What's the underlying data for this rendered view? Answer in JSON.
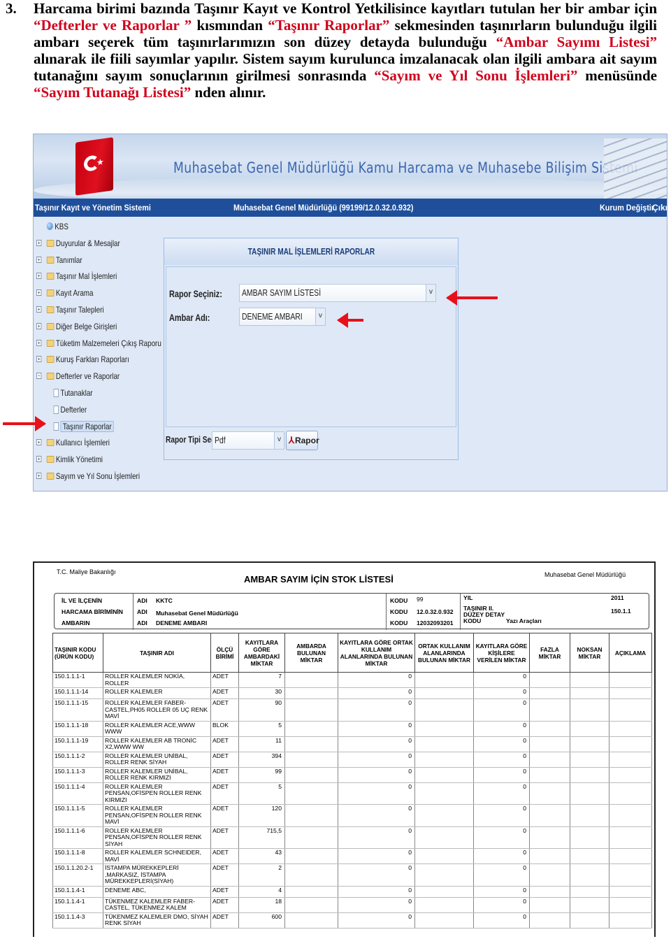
{
  "intro": {
    "number": "3.",
    "p1": "Harcama birimi bazında Taşınır Kayıt ve Kontrol Yetkilisince kayıtları tutulan her bir ambar için ",
    "p2": "“Defterler ve Raporlar ”",
    "p3": " kısmından ",
    "p4": "“Taşınır Raporlar”",
    "p5": " sekmesinden taşınırların bulunduğu ilgili ambarı seçerek tüm taşınırlarımızın son düzey detayda bulunduğu ",
    "p6": "“Ambar Sayımı Listesi”",
    "p7": " alınarak ile fiili sayımlar yapılır. Sistem sayım kurulunca imzalanacak olan ilgili ambara ait sayım tutanağını sayım sonuçlarının girilmesi sonrasında ",
    "p8": "“Sayım ve Yıl Sonu İşlemleri”",
    "p9": " menüsünde ",
    "p10": "“Sayım Tutanağı Listesi”",
    "p11": " nden alınır."
  },
  "app": {
    "banner_title": "Muhasebat Genel Müdürlüğü Kamu Harcama ve Muhasebe Bilişim Sistemi",
    "nav_left": "Taşınır Kayıt ve Yönetim Sistemi",
    "nav_center": "Muhasebat Genel Müdürlüğü (99199/12.0.32.0.932)",
    "nav_kurum": "Kurum Değiştir",
    "nav_exit": "Çıkış",
    "tree": {
      "root": "KBS",
      "items": [
        "Duyurular & Mesajlar",
        "Tanımlar",
        "Taşınır Mal İşlemleri",
        "Kayıt Arama",
        "Taşınır Talepleri",
        "Diğer Belge Girişleri",
        "Tüketim Malzemeleri Çıkış Raporu",
        "Kuruş Farkları Raporları",
        "Defterler ve Raporlar"
      ],
      "children": [
        "Tutanaklar",
        "Defterler",
        "Taşınır Raporlar"
      ],
      "items_after": [
        "Kullanıcı İşlemleri",
        "Kimlik Yönetimi",
        "Sayım ve Yıl Sonu İşlemleri"
      ]
    },
    "panel": {
      "title": "TAŞINIR MAL İŞLEMLERİ RAPORLAR",
      "rapor_label": "Rapor Seçiniz:",
      "rapor_value": "AMBAR SAYIM LİSTESİ",
      "ambar_label": "Ambar Adı:",
      "ambar_value": "DENEME AMBARI",
      "tip_label": "Rapor Tipi Seçiniz:",
      "tip_value": "Pdf",
      "rapor_button": "Rapor"
    }
  },
  "report": {
    "ministry": "T.C. Maliye Bakanlığı",
    "title": "AMBAR  SAYIM İÇİN STOK LİSTESİ",
    "department": "Muhasebat Genel Müdürlüğü",
    "header": {
      "r1_label": "İL VE İLÇENİN",
      "r1_adi": "ADI",
      "r1_val": "KKTC",
      "r1_kodu": "KODU",
      "r1_code": "99",
      "r2_label": "HARCAMA BİRİMİNİN",
      "r2_adi": "ADI",
      "r2_val": "Muhasebat Genel Müdürlüğü",
      "r2_kodu": "KODU",
      "r2_code": "12.0.32.0.932",
      "r3_label": "AMBARIN",
      "r3_adi": "ADI",
      "r3_val": "DENEME AMBARI",
      "r3_kodu": "KODU",
      "r3_code": "12032093201",
      "yil_label": "YIL",
      "yil_val": "2011",
      "tasinir_label": "TAŞINIR II. DÜZEY DETAY KODU",
      "tasinir_val": "150.1.1",
      "yazi": "Yazı Araçları"
    },
    "columns": [
      "TAŞINIR KODU (ÜRÜN KODU)",
      "TAŞINIR ADI",
      "ÖLÇÜ BİRİMİ",
      "KAYITLARA GÖRE AMBARDAKİ MİKTAR",
      "AMBARDA BULUNAN MİKTAR",
      "KAYITLARA GÖRE ORTAK KULLANIM ALANLARINDA BULUNAN MİKTAR",
      "ORTAK KULLANIM ALANLARINDA BULUNAN MİKTAR",
      "KAYITLARA GÖRE KİŞİLERE VERİLEN MİKTAR",
      "FAZLA MİKTAR",
      "NOKSAN MİKTAR",
      "AÇIKLAMA"
    ],
    "rows": [
      {
        "code": "150.1.1.1-1",
        "name": "ROLLER KALEMLER NOKİA, ROLLER",
        "unit": "ADET",
        "qty": "7",
        "ortak": "0",
        "kisi": "0"
      },
      {
        "code": "150.1.1.1-14",
        "name": "ROLLER KALEMLER",
        "unit": "ADET",
        "qty": "30",
        "ortak": "0",
        "kisi": "0"
      },
      {
        "code": "150.1.1.1-15",
        "name": "ROLLER KALEMLER FABER-CASTEL,PH05 ROLLER 05 UÇ RENK MAVİ",
        "unit": "ADET",
        "qty": "90",
        "ortak": "0",
        "kisi": "0"
      },
      {
        "code": "150.1.1.1-18",
        "name": "ROLLER KALEMLER ACE,WWW WWW",
        "unit": "BLOK",
        "qty": "5",
        "ortak": "0",
        "kisi": "0"
      },
      {
        "code": "150.1.1.1-19",
        "name": "ROLLER KALEMLER AB TRONİC X2,WWW WW",
        "unit": "ADET",
        "qty": "11",
        "ortak": "0",
        "kisi": "0"
      },
      {
        "code": "150.1.1.1-2",
        "name": "ROLLER KALEMLER UNİBAL, ROLLER RENK SİYAH",
        "unit": "ADET",
        "qty": "394",
        "ortak": "0",
        "kisi": "0"
      },
      {
        "code": "150.1.1.1-3",
        "name": "ROLLER KALEMLER UNİBAL, ROLLER RENK KIRMIZI",
        "unit": "ADET",
        "qty": "99",
        "ortak": "0",
        "kisi": "0"
      },
      {
        "code": "150.1.1.1-4",
        "name": "ROLLER KALEMLER PENSAN,OFİSPEN ROLLER RENK KIRMIZI",
        "unit": "ADET",
        "qty": "5",
        "ortak": "0",
        "kisi": "0"
      },
      {
        "code": "150.1.1.1-5",
        "name": "ROLLER KALEMLER PENSAN,OFİSPEN ROLLER RENK MAVİ",
        "unit": "ADET",
        "qty": "120",
        "ortak": "0",
        "kisi": "0"
      },
      {
        "code": "150.1.1.1-6",
        "name": "ROLLER KALEMLER PENSAN,OFİSPEN ROLLER RENK SİYAH",
        "unit": "ADET",
        "qty": "715,5",
        "ortak": "0",
        "kisi": "0"
      },
      {
        "code": "150.1.1.1-8",
        "name": "ROLLER KALEMLER SCHNEIDER, MAVİ",
        "unit": "ADET",
        "qty": "43",
        "ortak": "0",
        "kisi": "0"
      },
      {
        "code": "150.1.1.20.2-1",
        "name": "İSTAMPA MÜREKKEPLERİ ,MARKASIZ, İSTAMPA MÜREKKEPLERİ(SİYAH)",
        "unit": "ADET",
        "qty": "2",
        "ortak": "0",
        "kisi": "0"
      },
      {
        "code": "150.1.1.4-1",
        "name": "DENEME ABC,",
        "unit": "ADET",
        "qty": "4",
        "ortak": "0",
        "kisi": "0"
      },
      {
        "code": "150.1.1.4-1",
        "name": "TÜKENMEZ KALEMLER FABER-CASTEL, TÜKENMEZ KALEM",
        "unit": "ADET",
        "qty": "18",
        "ortak": "0",
        "kisi": "0"
      },
      {
        "code": "150.1.1.4-3",
        "name": "TÜKENMEZ KALEMLER DMO, SİYAH RENK SİYAH",
        "unit": "ADET",
        "qty": "600",
        "ortak": "0",
        "kisi": "0"
      }
    ]
  },
  "colors": {
    "accent_red": "#d0021b",
    "nav_blue": "#1f4f9a",
    "panel_bg": "#dfe8f6"
  }
}
